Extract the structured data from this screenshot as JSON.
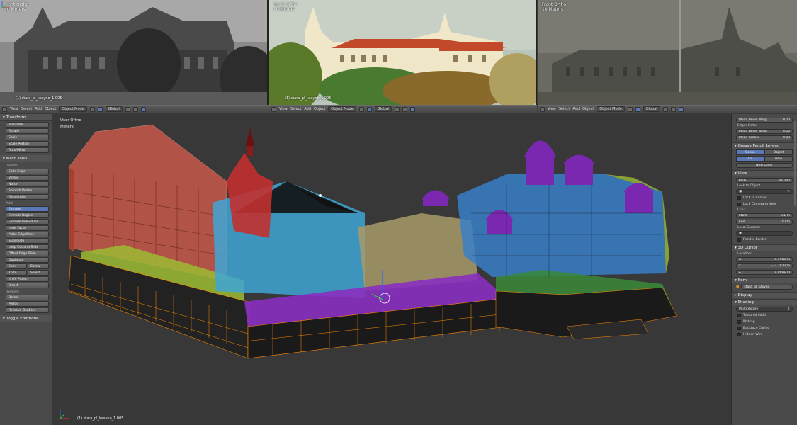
{
  "reference_views": [
    {
      "view_name": "Front Ortho",
      "scale": "50 Meters",
      "object": "(1) stara_pl_kasyno_1.005"
    },
    {
      "view_name": "Front Ortho",
      "scale": "10 Meters",
      "object": "(1) stara_pl_kasyno_1.005"
    },
    {
      "view_name": "Front Ortho",
      "scale": "10 Meters",
      "object": ""
    }
  ],
  "view_header": {
    "menus": [
      "View",
      "Select",
      "Add",
      "Object"
    ],
    "mode": "Object Mode",
    "pivot": "Global"
  },
  "main_view": {
    "view_name": "User Ortho",
    "units": "Meters",
    "object": "(1) stara_pl_kasyno_1.005"
  },
  "tool_shelf": {
    "transform": {
      "title": "Transform",
      "buttons": [
        "Translate",
        "Rotate",
        "Scale",
        "Scale Portion",
        "Auto-Mirror"
      ]
    },
    "mesh_tools": {
      "title": "Mesh Tools",
      "deform_label": "Deform:",
      "deform_buttons": [
        "Slide Edge",
        "Vertex",
        "Noise",
        "Smooth Vertex",
        "Randomize"
      ],
      "add_label": "Add:",
      "add_buttons": [
        "Extrude",
        "Extrude Region",
        "Extrude Individual",
        "Inset Faces",
        "Make Edge/Face",
        "Subdivide",
        "Loop Cut and Slide",
        "Offset Edge Slide",
        "Duplicate",
        "Spin",
        "Screw",
        "Knife",
        "Select",
        "Knife Project",
        "Bisect"
      ],
      "remove_label": "Remove:",
      "remove_buttons": [
        "Delete",
        "Merge",
        "Remove Doubles"
      ]
    },
    "toggle_editmode": "Toggle Editmode"
  },
  "properties": {
    "top_fields": [
      {
        "label": "Mean Bevel Weig",
        "value": "0.00"
      },
      {
        "label": "Edges Data:",
        "value": ""
      },
      {
        "label": "Mean Bevel Weig",
        "value": "0.00"
      },
      {
        "label": "Mean Crease",
        "value": "0.00"
      }
    ],
    "grease_pencil": {
      "title": "Grease Pencil Layers",
      "tabs": [
        "Scene",
        "Object"
      ],
      "tab_active": 0,
      "layer": {
        "name": "GP",
        "action": "New"
      },
      "new_layer": "New Layer"
    },
    "view": {
      "title": "View",
      "lens": {
        "label": "Lens",
        "value": "35 mm"
      },
      "lock_to_object": "Lock to Object",
      "lock_to_cursor": "Lock to Cursor",
      "lock_camera": "Lock Camera to View",
      "clip_label": "Clip:",
      "clip_start": {
        "label": "Start",
        "value": "0.1 m"
      },
      "clip_end": {
        "label": "End",
        "value": "10 km"
      },
      "local_camera": "Local Camera:",
      "render_border": "Render Border"
    },
    "cursor": {
      "title": "3D Cursor",
      "location_label": "Location:",
      "x": {
        "label": "X",
        "value": "-0.4969 m"
      },
      "y": {
        "label": "Y",
        "value": "-32.2922 m"
      },
      "z": {
        "label": "Z",
        "value": "0.0001 m"
      }
    },
    "item": {
      "title": "Item",
      "object_name": "stara_pl_kasyno"
    },
    "display": {
      "title": "Display"
    },
    "shading": {
      "title": "Shading",
      "mode": "Multitexture",
      "options": [
        "Textured Solid",
        "Matcap",
        "Backface Culling",
        "Hidden Wire"
      ]
    }
  },
  "colors": {
    "accent": "#5b78b5",
    "panel": "#4a4a4a",
    "viewport": "#383838",
    "wing_red": "#c8584a",
    "wing_cyan": "#3ea6d6",
    "wing_purple": "#8a2fc0",
    "wing_tan": "#a89a6a",
    "wing_olive": "#9bbb33",
    "wing_green": "#3a8a3a",
    "wire_orange": "#ff8a00"
  }
}
